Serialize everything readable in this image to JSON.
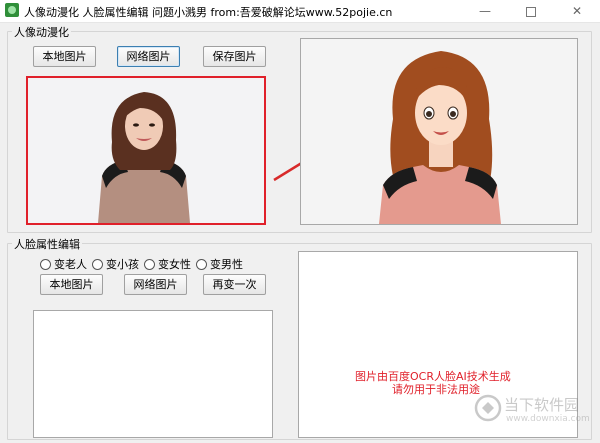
{
  "window": {
    "title": "人像动漫化 人脸属性编辑 问题小溅男 from:吾爱破解论坛www.52pojie.cn",
    "minimize_symbol": "—",
    "close_symbol": "✕"
  },
  "anime_section": {
    "label": "人像动漫化",
    "buttons": {
      "local": "本地图片",
      "network": "网络图片",
      "save": "保存图片"
    }
  },
  "face_section": {
    "label": "人脸属性编辑",
    "radios": [
      "变老人",
      "变小孩",
      "变女性",
      "变男性"
    ],
    "buttons": {
      "local": "本地图片",
      "network": "网络图片",
      "again": "再变一次"
    },
    "notice_line1": "图片由百度OCR人脸AI技术生成",
    "notice_line2": "请勿用于非法用途"
  },
  "watermark": {
    "main": "当下软件园",
    "sub": "www.downxia.com"
  },
  "colors": {
    "highlight_border": "#e0202a",
    "arrow": "#d82a2a",
    "notice_text": "#e0202a"
  }
}
